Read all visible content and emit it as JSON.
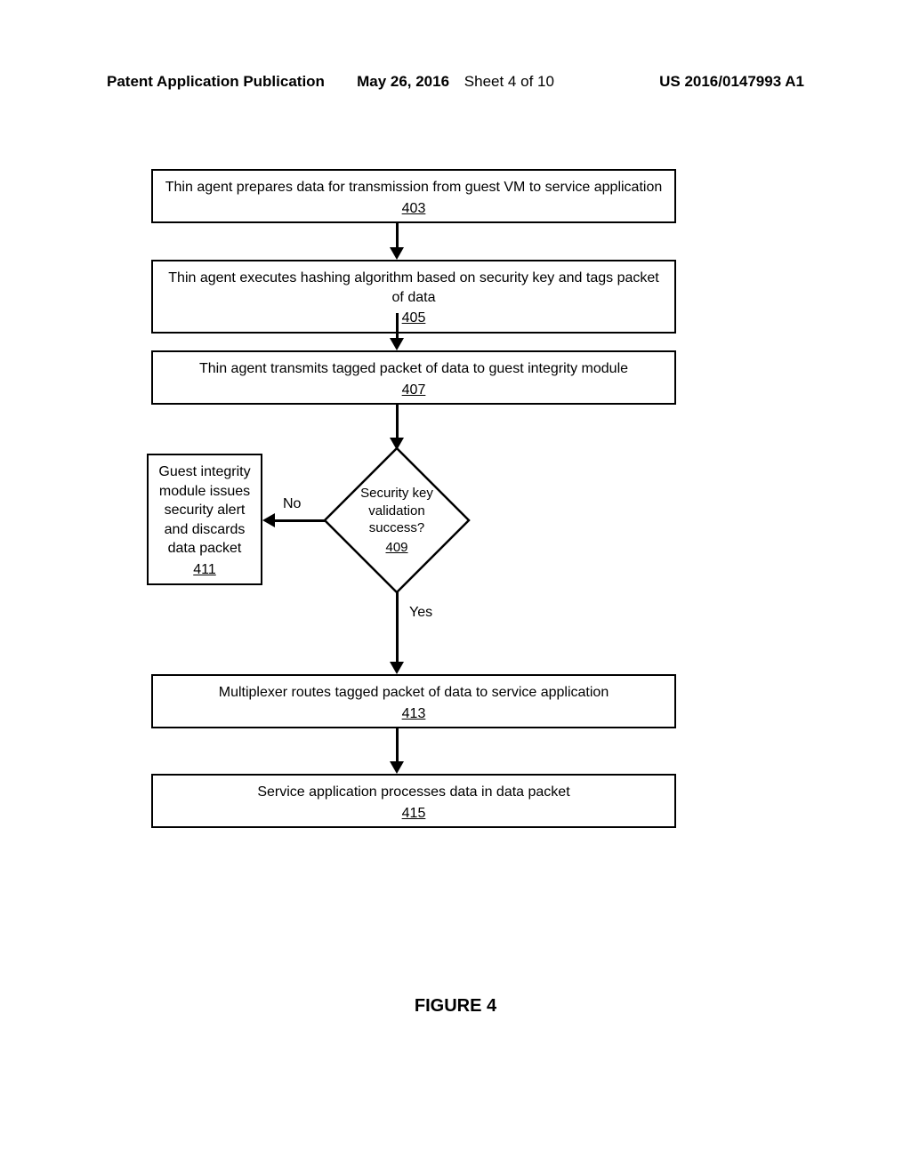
{
  "header": {
    "left": "Patent Application Publication",
    "date": "May 26, 2016",
    "sheet": "Sheet 4 of 10",
    "right": "US 2016/0147993 A1"
  },
  "chart_data": {
    "type": "flowchart",
    "nodes": [
      {
        "id": "403",
        "shape": "rect",
        "text": "Thin agent prepares data for transmission from guest VM to service application",
        "ref": "403"
      },
      {
        "id": "405",
        "shape": "rect",
        "text": "Thin agent executes hashing algorithm based on security key and tags packet of data",
        "ref": "405"
      },
      {
        "id": "407",
        "shape": "rect",
        "text": "Thin agent transmits tagged packet of data to guest integrity module",
        "ref": "407"
      },
      {
        "id": "409",
        "shape": "diamond",
        "text": "Security key validation success?",
        "ref": "409"
      },
      {
        "id": "411",
        "shape": "rect",
        "text": "Guest integrity module issues security alert and discards data packet",
        "ref": "411"
      },
      {
        "id": "413",
        "shape": "rect",
        "text": "Multiplexer routes tagged packet of data to service application",
        "ref": "413"
      },
      {
        "id": "415",
        "shape": "rect",
        "text": "Service application processes data in data packet",
        "ref": "415"
      }
    ],
    "edges": [
      {
        "from": "403",
        "to": "405",
        "label": ""
      },
      {
        "from": "405",
        "to": "407",
        "label": ""
      },
      {
        "from": "407",
        "to": "409",
        "label": ""
      },
      {
        "from": "409",
        "to": "411",
        "label": "No"
      },
      {
        "from": "409",
        "to": "413",
        "label": "Yes"
      },
      {
        "from": "413",
        "to": "415",
        "label": ""
      }
    ]
  },
  "labels": {
    "no": "No",
    "yes": "Yes"
  },
  "figure_caption": "FIGURE 4"
}
